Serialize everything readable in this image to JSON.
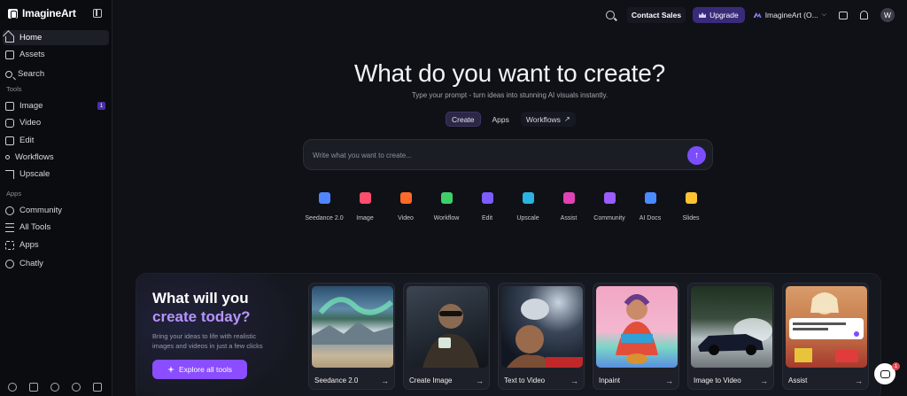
{
  "brand": {
    "name": "ImagineArt"
  },
  "sidebar": {
    "items_top": [
      {
        "label": "Home",
        "icon": "home-icon",
        "active": true
      },
      {
        "label": "Assets",
        "icon": "folder-icon"
      },
      {
        "label": "Search",
        "icon": "search-icon"
      }
    ],
    "tools_heading": "Tools",
    "tools": [
      {
        "label": "Image",
        "icon": "image-icon",
        "badge": "1"
      },
      {
        "label": "Video",
        "icon": "video-icon"
      },
      {
        "label": "Edit",
        "icon": "edit-icon"
      },
      {
        "label": "Workflows",
        "icon": "workflow-icon"
      },
      {
        "label": "Upscale",
        "icon": "upscale-icon"
      }
    ],
    "apps_heading": "Apps",
    "apps": [
      {
        "label": "Community",
        "icon": "globe-icon"
      },
      {
        "label": "All Tools",
        "icon": "list-icon"
      },
      {
        "label": "Apps",
        "icon": "apps-icon"
      },
      {
        "label": "Chatly",
        "icon": "chat-icon"
      }
    ],
    "footer_icons": [
      "settings-icon",
      "discord-icon",
      "reddit-icon",
      "help-icon",
      "mobile-icon"
    ]
  },
  "topbar": {
    "contact_label": "Contact Sales",
    "upgrade_label": "Upgrade",
    "workspace_label": "ImagineArt (O...",
    "avatar_initial": "W"
  },
  "hero": {
    "title": "What do you want to create?",
    "subtitle": "Type your prompt - turn ideas into stunning AI visuals instantly.",
    "tabs": [
      {
        "label": "Create",
        "active": true
      },
      {
        "label": "Apps"
      },
      {
        "label": "Workflows",
        "external": true
      }
    ],
    "prompt_placeholder": "Write what you want to create..."
  },
  "tools_row": [
    {
      "label": "Seedance 2.0",
      "color": "#4f86ff",
      "icon": "bars-icon"
    },
    {
      "label": "Image",
      "color": "#ff4d6d",
      "icon": "image-icon"
    },
    {
      "label": "Video",
      "color": "#ff6a2b",
      "icon": "video-icon"
    },
    {
      "label": "Workflow",
      "color": "#3fcf6a",
      "icon": "workflow-icon"
    },
    {
      "label": "Edit",
      "color": "#7b5cff",
      "icon": "edit-icon"
    },
    {
      "label": "Upscale",
      "color": "#2bb3e0",
      "icon": "upscale-icon"
    },
    {
      "label": "Assist",
      "color": "#e042b5",
      "icon": "assist-icon"
    },
    {
      "label": "Community",
      "color": "#9a5cff",
      "icon": "globe-icon"
    },
    {
      "label": "AI Docs",
      "color": "#4a8bff",
      "icon": "docs-icon"
    },
    {
      "label": "Slides",
      "color": "#ffc233",
      "icon": "slides-icon"
    }
  ],
  "promo": {
    "title_line1": "What will you",
    "title_line2": "create today?",
    "description": "Bring your ideas to life with realistic images and videos in just a few clicks",
    "cta_label": "Explore all tools",
    "cards": [
      {
        "label": "Seedance 2.0"
      },
      {
        "label": "Create Image"
      },
      {
        "label": "Text to Video"
      },
      {
        "label": "Inpaint"
      },
      {
        "label": "Image to Video"
      },
      {
        "label": "Assist"
      }
    ]
  },
  "chat_widget": {
    "badge": "1"
  },
  "colors": {
    "accent": "#8a4dff",
    "background": "#0f1117"
  }
}
